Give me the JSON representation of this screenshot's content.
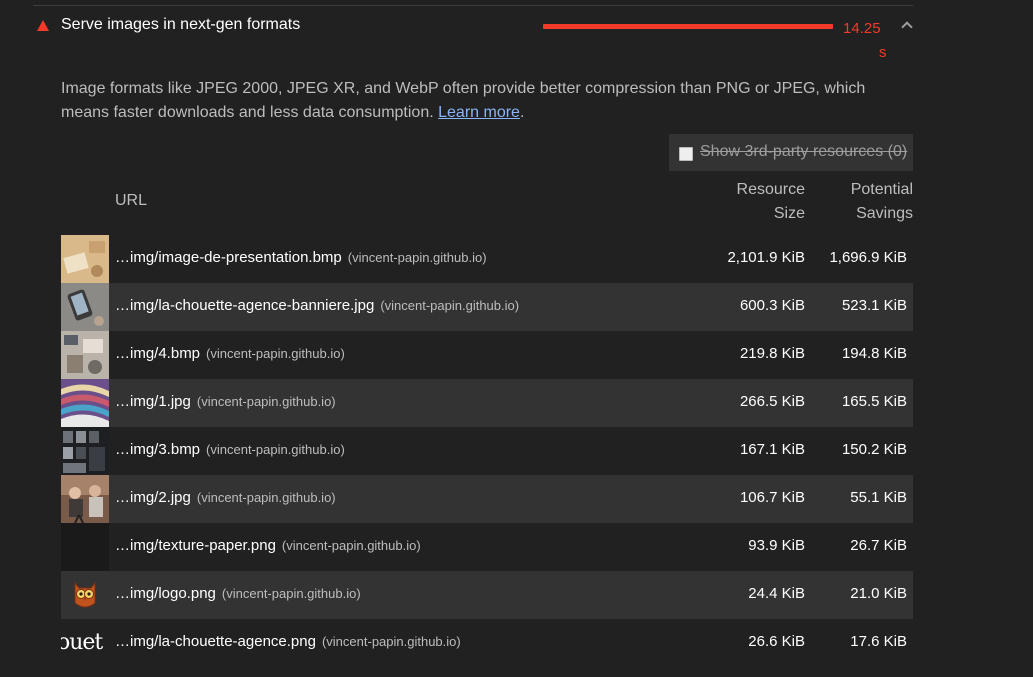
{
  "audit": {
    "title": "Serve images in next-gen formats",
    "savings_value": "14.25",
    "savings_unit": "s",
    "status_color": "#f33a2a",
    "description": "Image formats like JPEG 2000, JPEG XR, and WebP often provide better compression than PNG or JPEG, which means faster downloads and less data consumption.",
    "learn_more": "Learn more",
    "period": "."
  },
  "filter": {
    "label": "Show 3rd-party resources",
    "count": "(0)"
  },
  "table": {
    "headers": {
      "url": "URL",
      "size_line1": "Resource",
      "size_line2": "Size",
      "savings_line1": "Potential",
      "savings_line2": "Savings"
    },
    "rows": [
      {
        "url": "…img/image-de-presentation.bmp",
        "host": "(vincent-papin.github.io)",
        "size": "2,101.9 KiB",
        "savings": "1,696.9 KiB",
        "thumb": "desk-photo-thumbnail"
      },
      {
        "url": "…img/la-chouette-agence-banniere.jpg",
        "host": "(vincent-papin.github.io)",
        "size": "600.3 KiB",
        "savings": "523.1 KiB",
        "thumb": "phone-photo-thumbnail"
      },
      {
        "url": "…img/4.bmp",
        "host": "(vincent-papin.github.io)",
        "size": "219.8 KiB",
        "savings": "194.8 KiB",
        "thumb": "workspace-photo-thumbnail"
      },
      {
        "url": "…img/1.jpg",
        "host": "(vincent-papin.github.io)",
        "size": "266.5 KiB",
        "savings": "165.5 KiB",
        "thumb": "fabric-photo-thumbnail"
      },
      {
        "url": "…img/3.bmp",
        "host": "(vincent-papin.github.io)",
        "size": "167.1 KiB",
        "savings": "150.2 KiB",
        "thumb": "dark-gallery-thumbnail"
      },
      {
        "url": "…img/2.jpg",
        "host": "(vincent-papin.github.io)",
        "size": "106.7 KiB",
        "savings": "55.1 KiB",
        "thumb": "people-photo-thumbnail"
      },
      {
        "url": "…img/texture-paper.png",
        "host": "(vincent-papin.github.io)",
        "size": "93.9 KiB",
        "savings": "26.7 KiB",
        "thumb": "texture-thumbnail"
      },
      {
        "url": "…img/logo.png",
        "host": "(vincent-papin.github.io)",
        "size": "24.4 KiB",
        "savings": "21.0 KiB",
        "thumb": "owl-logo-thumbnail"
      },
      {
        "url": "…img/la-chouette-agence.png",
        "host": "(vincent-papin.github.io)",
        "size": "26.6 KiB",
        "savings": "17.6 KiB",
        "thumb": "wordmark-thumbnail",
        "thumb_text": "ouet"
      }
    ]
  }
}
